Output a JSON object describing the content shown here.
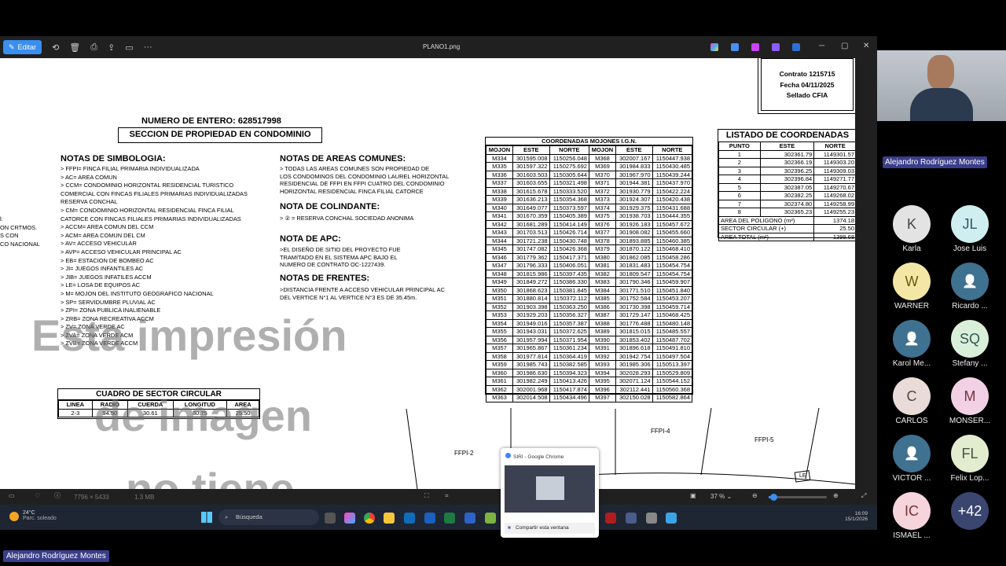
{
  "window": {
    "title": "PLANO1.png",
    "edit_label": "Editar"
  },
  "doc": {
    "contract": [
      "Contrato 1215715",
      "Fecha 04/11/2025",
      "Sellado CFIA"
    ],
    "entry_number": "NUMERO DE ENTERO: 628517998",
    "section_title": "SECCION DE PROPIEDAD EN CONDOMINIO",
    "simbologia_title": "NOTAS DE SIMBOLOGIA:",
    "simbologia": [
      ">  FFPI= FINCA FILIAL PRIMARIA INDIVIDUALIZADA",
      ">  AC= AREA COMUN",
      ">  CCM= CONDOMINIO HORIZONTAL RESIDENCIAL TURISTICO",
      "    COMERCIAL CON FINCAS FILIALES PRIMARIAS INDIVIDUALIZADAS",
      "    RESERVA CONCHAL",
      ">  CM= CONDOMINIO HORIZONTAL RESIDENCIAL FINCA FILIAL",
      "    CATORCE CON FINCAS FILIALES PRIMARIAS INDIVIDUALIZADAS",
      ">  ACCM= AREA COMUN DEL CCM",
      ">  ACM= AREA COMUN DEL CM",
      ">  AV= ACCESO VEHICULAR",
      ">  AVP= ACCESO VEHICULAR PRINCIPAL AC",
      ">  EB= ESTACION DE BOMBEO AC",
      ">  JI= JUEGOS INFANTILES AC",
      ">  JIB= JUEGOS INFATILES ACCM",
      ">  LE= LOSA DE EQUIPOS AC",
      ">  M= MOJON DEL INSTITUTO GEOGRAFICO NACIONAL",
      ">  SP= SERVIDUMBRE PLUVIAL AC",
      ">  ZPI= ZONA PUBLICA INALIENABLE",
      ">  ZRB= ZONA RECREATIVA ACCM",
      ">  ZV= ZONA VERDE AC",
      ">  ZVA= ZONA VERDE ACM",
      ">  ZVB= ZONA VERDE ACCM"
    ],
    "left_edge": [
      "l:",
      "ON CRTMOS.",
      "S CON",
      "",
      "CO NACIONAL"
    ],
    "areas_title": "NOTAS DE AREAS COMUNES:",
    "areas": [
      ">  TODAS LAS  AREAS COMUNES SON PROPIEDAD DE",
      "   LOS CONDOMINOS DEL CONDOMINIO LAUREL HORIZONTAL",
      "   RESIDENCIAL DE FFPI EN FFPI CUATRO DEL CONDOMINIO",
      "   HORIZONTAL RESIDENCIAL FINCA FILIAL CATORCE"
    ],
    "colindante_title": "NOTA DE COLINDANTE:",
    "colindante": ">  ② = RESERVA CONCHAL SOCIEDAD ANONIMA",
    "apc_title": "NOTA DE APC:",
    "apc": [
      ">EL DISEÑO DE SITIO DEL PROYECTO FUE",
      "  TRAMITADO EN EL SISTEMA APC BAJO EL",
      "  NUMERO DE CONTRATO OC-1227439."
    ],
    "frentes_title": "NOTAS DE FRENTES:",
    "frentes": [
      ">DISTANCIA FRENTE A ACCESO VEHICULAR PRINCIPAL AC",
      "  DEL VERTICE  N°1 AL VERTICE N°3 ES DE 35.45m."
    ],
    "watermark": [
      "Esta impresión",
      "de imagen",
      "no tiene"
    ],
    "circular": {
      "title": "CUADRO DE SECTOR CIRCULAR",
      "headers": [
        "LINEA",
        "RADIO",
        "CUERDA",
        "LONGITUD",
        "AREA"
      ],
      "row": [
        "2-3",
        "94.50",
        "30.61",
        "30.75",
        "25.50"
      ]
    },
    "mojones_title": "COORDENADAS MOJONES I.G.N.",
    "mojones_headers": [
      "MOJON",
      "ESTE",
      "NORTE",
      "MOJON",
      "ESTE",
      "NORTE"
    ],
    "mojones": [
      [
        "M334",
        "301595.008",
        "1150256.048",
        "M368",
        "302007.167",
        "1150447.938"
      ],
      [
        "M335",
        "301597.322",
        "1150275.692",
        "M369",
        "301984.833",
        "1150430.485"
      ],
      [
        "M336",
        "301603.503",
        "1150305.644",
        "M370",
        "301967.970",
        "1150439.244"
      ],
      [
        "M337",
        "301603.655",
        "1150321.498",
        "M371",
        "301944.381",
        "1150437.970"
      ],
      [
        "M338",
        "301615.678",
        "1150333.520",
        "M372",
        "301930.779",
        "1150422.224"
      ],
      [
        "M339",
        "301636.213",
        "1150354.368",
        "M373",
        "301924.307",
        "1150420.438"
      ],
      [
        "M340",
        "301649.077",
        "1150373.597",
        "M374",
        "301929.375",
        "1150431.688"
      ],
      [
        "M341",
        "301670.359",
        "1150405.389",
        "M375",
        "301938.703",
        "1150444.355"
      ],
      [
        "M342",
        "301681.289",
        "1150414.149",
        "M376",
        "301926.183",
        "1150457.672"
      ],
      [
        "M343",
        "301703.513",
        "1150426.714",
        "M377",
        "301908.082",
        "1150455.660"
      ],
      [
        "M344",
        "301721.238",
        "1150430.748",
        "M378",
        "301893.885",
        "1150460.385"
      ],
      [
        "M345",
        "301747.082",
        "1150426.368",
        "M379",
        "301870.122",
        "1150468.410"
      ],
      [
        "M346",
        "301779.362",
        "1150417.371",
        "M380",
        "301862.085",
        "1150458.286"
      ],
      [
        "M347",
        "301796.333",
        "1150406.051",
        "M381",
        "301831.483",
        "1150454.754"
      ],
      [
        "M348",
        "301815.986",
        "1150397.435",
        "M382",
        "301809.547",
        "1150454.754"
      ],
      [
        "M349",
        "301849.272",
        "1150386.330",
        "M383",
        "301790.346",
        "1150459.907"
      ],
      [
        "M350",
        "301868.623",
        "1150381.845",
        "M384",
        "301771.510",
        "1150451.840"
      ],
      [
        "M351",
        "301880.814",
        "1150372.112",
        "M385",
        "301752.584",
        "1150453.207"
      ],
      [
        "M352",
        "301903.398",
        "1150363.250",
        "M386",
        "301730.398",
        "1150459.714"
      ],
      [
        "M353",
        "301929.203",
        "1150356.327",
        "M387",
        "301729.147",
        "1150468.425"
      ],
      [
        "M354",
        "301949.016",
        "1150357.387",
        "M388",
        "301776.488",
        "1150480.148"
      ],
      [
        "M355",
        "301943.031",
        "1150372.625",
        "M389",
        "301815.015",
        "1150485.557"
      ],
      [
        "M356",
        "301957.994",
        "1150371.954",
        "M390",
        "301853.402",
        "1150487.702"
      ],
      [
        "M357",
        "301965.867",
        "1150361.234",
        "M391",
        "301896.618",
        "1150491.810"
      ],
      [
        "M358",
        "301977.814",
        "1150364.419",
        "M392",
        "301942.754",
        "1150497.504"
      ],
      [
        "M359",
        "301985.743",
        "1150382.585",
        "M393",
        "301985.306",
        "1150513.397"
      ],
      [
        "M360",
        "301986.630",
        "1150394.323",
        "M394",
        "302028.293",
        "1150529.809"
      ],
      [
        "M361",
        "301982.249",
        "1150413.426",
        "M395",
        "302071.124",
        "1150544.152"
      ],
      [
        "M362",
        "302001.968",
        "1150417.874",
        "M396",
        "302112.441",
        "1150560.368"
      ],
      [
        "M363",
        "302014.508",
        "1150434.496",
        "M397",
        "302150.028",
        "1150582.864"
      ]
    ],
    "coords_title": "LISTADO DE COORDENADAS",
    "coords_headers": [
      "PUNTO",
      "ESTE",
      "NORTE"
    ],
    "coords": [
      [
        "1",
        "302361.79",
        "1149301.57"
      ],
      [
        "2",
        "302366.19",
        "1149303.20"
      ],
      [
        "3",
        "302396.25",
        "1149309.03"
      ],
      [
        "4",
        "302396.84",
        "1149271.77"
      ],
      [
        "5",
        "302387.05",
        "1149270.67"
      ],
      [
        "6",
        "302382.25",
        "1149268.02"
      ],
      [
        "7",
        "302374.80",
        "1149258.99"
      ],
      [
        "8",
        "302365.23",
        "1149255.23"
      ]
    ],
    "coords_summary": [
      [
        "AREA DEL POLIGONO  (m²)",
        "1374.18"
      ],
      [
        "SECTOR CIRCULAR  (+)",
        "25.50"
      ],
      [
        "AREA TOTAL  (m²)",
        "1399.68"
      ]
    ],
    "plan_labels": [
      "FFPI-2",
      "FFPI-4",
      "FFPI-5",
      "LE"
    ]
  },
  "status": {
    "dims": "7796 × 5433",
    "size": "1.3 MB",
    "zoom": "37 %"
  },
  "thumbnail": {
    "title": "SIRI - Google Chrome",
    "share": "Compartir esta ventana"
  },
  "taskbar": {
    "temp": "24°C",
    "weather": "Parc. soleado",
    "search": "Búsqueda",
    "time": "16:09",
    "date": "15/1/2026"
  },
  "presenter": "Alejandro Rodríguez Montes",
  "video_name": "Alejandro Rodríguez Montes",
  "participants": [
    {
      "initials": "K",
      "name": "Karla",
      "color": "#e3e3e3",
      "fg": "#444"
    },
    {
      "initials": "JL",
      "name": "Jose Luis",
      "color": "#cfeef0",
      "fg": "#356"
    },
    {
      "initials": "W",
      "name": "WARNER",
      "color": "#f4e7a5",
      "fg": "#6a5a10"
    },
    {
      "initials": "",
      "name": "Ricardo ...",
      "color": "#3f7190",
      "fg": "#fff"
    },
    {
      "initials": "",
      "name": "Karol Me...",
      "color": "#3f7190",
      "fg": "#fff"
    },
    {
      "initials": "SQ",
      "name": "Stefany ...",
      "color": "#d9efd9",
      "fg": "#355"
    },
    {
      "initials": "C",
      "name": "CARLOS",
      "color": "#e9dcd8",
      "fg": "#544"
    },
    {
      "initials": "M",
      "name": "MONSER...",
      "color": "#f3d1e5",
      "fg": "#734"
    },
    {
      "initials": "",
      "name": "VICTOR ...",
      "color": "#3f7190",
      "fg": "#fff"
    },
    {
      "initials": "FL",
      "name": "Felix Lop...",
      "color": "#e4eccf",
      "fg": "#454"
    },
    {
      "initials": "IC",
      "name": "ISMAEL ...",
      "color": "#f5d4dc",
      "fg": "#733"
    },
    {
      "initials": "+42",
      "name": "",
      "color": "#3a4670",
      "fg": "#fff"
    }
  ]
}
